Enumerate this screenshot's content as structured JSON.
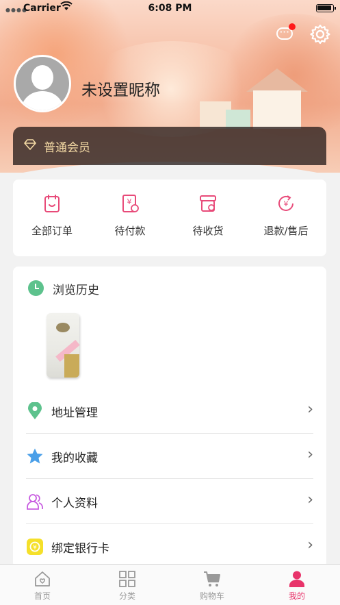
{
  "status_bar": {
    "carrier": "Carrier",
    "time": "6:08 PM"
  },
  "profile": {
    "nickname": "未设置昵称",
    "member_level": "普通会员"
  },
  "orders": [
    {
      "label": "全部订单",
      "icon": "clipboard-icon"
    },
    {
      "label": "待付款",
      "icon": "payment-icon"
    },
    {
      "label": "待收货",
      "icon": "package-icon"
    },
    {
      "label": "退款/售后",
      "icon": "refund-icon"
    }
  ],
  "history": {
    "title": "浏览历史"
  },
  "menu": [
    {
      "label": "地址管理",
      "icon": "location-pin-icon"
    },
    {
      "label": "我的收藏",
      "icon": "star-icon"
    },
    {
      "label": "个人资料",
      "icon": "people-icon"
    },
    {
      "label": "绑定银行卡",
      "icon": "bank-card-icon"
    }
  ],
  "tabbar": [
    {
      "label": "首页",
      "icon": "home-icon"
    },
    {
      "label": "分类",
      "icon": "grid-icon"
    },
    {
      "label": "购物车",
      "icon": "cart-icon"
    },
    {
      "label": "我的",
      "icon": "user-icon"
    }
  ],
  "colors": {
    "accent": "#e8336a",
    "order_icon": "#e84a79",
    "notification_dot": "#ff1a1a",
    "member_gold": "#f3d9a4"
  }
}
